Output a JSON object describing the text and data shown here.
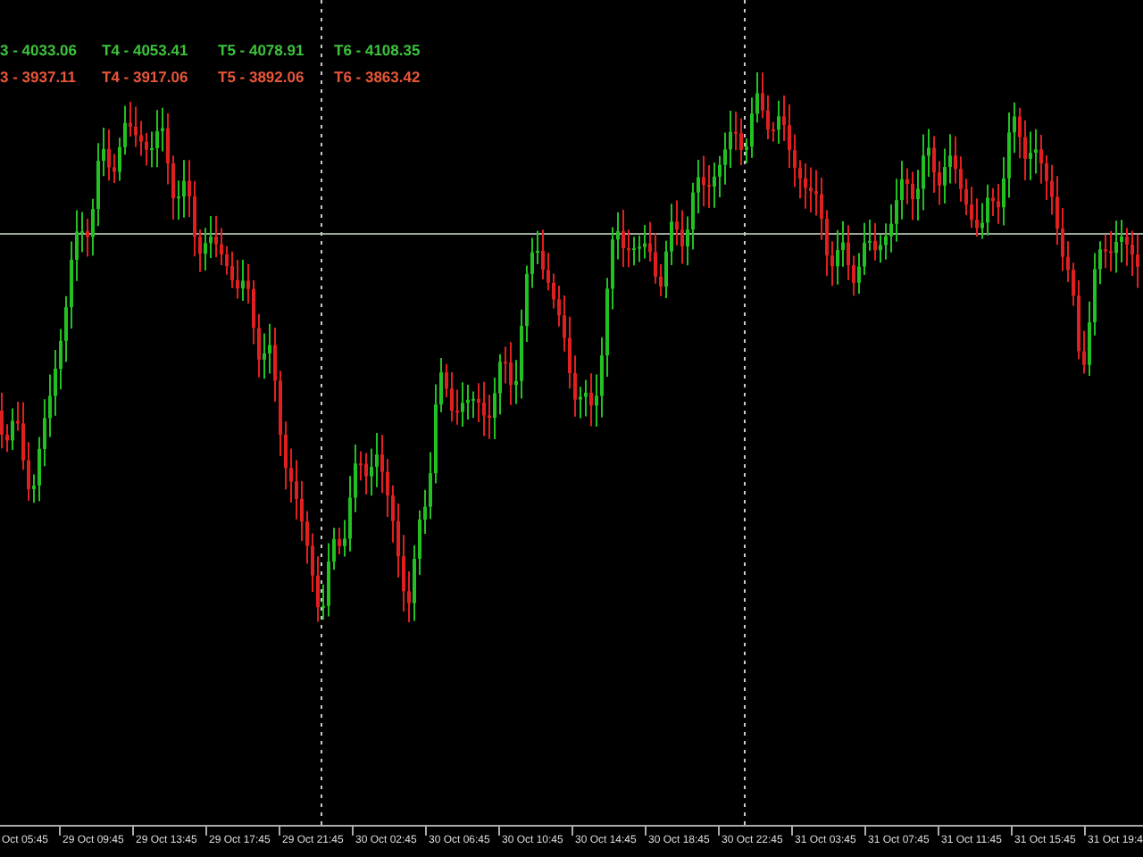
{
  "target_rows": [
    {
      "color": "#3cc23c",
      "labels": [
        "3 - 4033.06",
        "T4 - 4053.41",
        "T5 - 4078.91",
        "T6 - 4108.35"
      ]
    },
    {
      "color": "#e8563a",
      "labels": [
        "3 - 3937.11",
        "T4 - 3917.06",
        "T5 - 3892.06",
        "T6 - 3863.42"
      ]
    }
  ],
  "time_axis": {
    "labels": [
      "Oct 05:45",
      "29 Oct 09:45",
      "29 Oct 13:45",
      "29 Oct 17:45",
      "29 Oct 21:45",
      "30 Oct 02:45",
      "30 Oct 06:45",
      "30 Oct 10:45",
      "30 Oct 14:45",
      "30 Oct 18:45",
      "30 Oct 22:45",
      "31 Oct 03:45",
      "31 Oct 07:45",
      "31 Oct 11:45",
      "31 Oct 15:45",
      "31 Oct 19:4"
    ]
  }
}
